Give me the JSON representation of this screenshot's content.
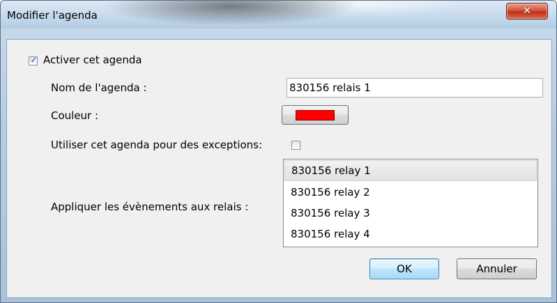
{
  "window": {
    "title": "Modifier l'agenda",
    "close_glyph": "✕"
  },
  "form": {
    "enable": {
      "label": "Activer cet agenda",
      "checked": true,
      "check_glyph": "✓"
    },
    "name": {
      "label": "Nom de l'agenda :",
      "value": "830156 relais 1"
    },
    "color": {
      "label": "Couleur :",
      "swatch_color": "#ff0000"
    },
    "exceptions": {
      "label": "Utiliser cet agenda pour des exceptions:",
      "checked": false
    },
    "relays": {
      "label": "Appliquer les évènements aux relais :",
      "items": [
        {
          "label": "830156 relay 1",
          "selected": true
        },
        {
          "label": "830156 relay 2",
          "selected": false
        },
        {
          "label": "830156 relay 3",
          "selected": false
        },
        {
          "label": "830156 relay 4",
          "selected": false
        }
      ]
    }
  },
  "buttons": {
    "ok_label": "OK",
    "cancel_label": "Annuler"
  }
}
